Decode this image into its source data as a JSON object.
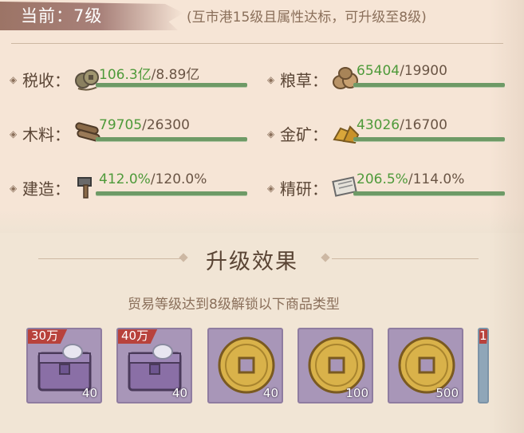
{
  "header": {
    "level_label": "当前：7级",
    "condition": "(互市港15级且属性达标，可升级至8级)"
  },
  "stats": [
    {
      "label": "税收：",
      "current": "106.3亿",
      "max": "8.89亿",
      "icon": "coin-string-icon"
    },
    {
      "label": "粮草：",
      "current": "65404",
      "max": "19900",
      "icon": "grain-sack-icon"
    },
    {
      "label": "木料：",
      "current": "79705",
      "max": "26300",
      "icon": "wood-logs-icon"
    },
    {
      "label": "金矿：",
      "current": "43026",
      "max": "16700",
      "icon": "gold-ore-icon"
    },
    {
      "label": "建造：",
      "current": "412.0%",
      "max": "120.0%",
      "icon": "hammer-icon"
    },
    {
      "label": "精研：",
      "current": "206.5%",
      "max": "114.0%",
      "icon": "scroll-icon"
    }
  ],
  "section": {
    "title": "升级效果",
    "subtitle": "贸易等级达到8级解锁以下商品类型"
  },
  "items": [
    {
      "tag": "30万",
      "count": "40",
      "icon": "purple-chest-icon"
    },
    {
      "tag": "40万",
      "count": "40",
      "icon": "purple-chest-icon"
    },
    {
      "tag": "",
      "count": "40",
      "icon": "gold-coin-icon"
    },
    {
      "tag": "",
      "count": "100",
      "icon": "gold-coin-icon"
    },
    {
      "tag": "",
      "count": "500",
      "icon": "gold-coin-icon"
    },
    {
      "tag": "1",
      "count": "",
      "icon": "partial-item-icon"
    }
  ],
  "colors": {
    "accent_green": "#4e9a3a",
    "bar_green": "#6e9a66",
    "card_purple": "#a896b8",
    "tag_red": "#b8423c"
  }
}
